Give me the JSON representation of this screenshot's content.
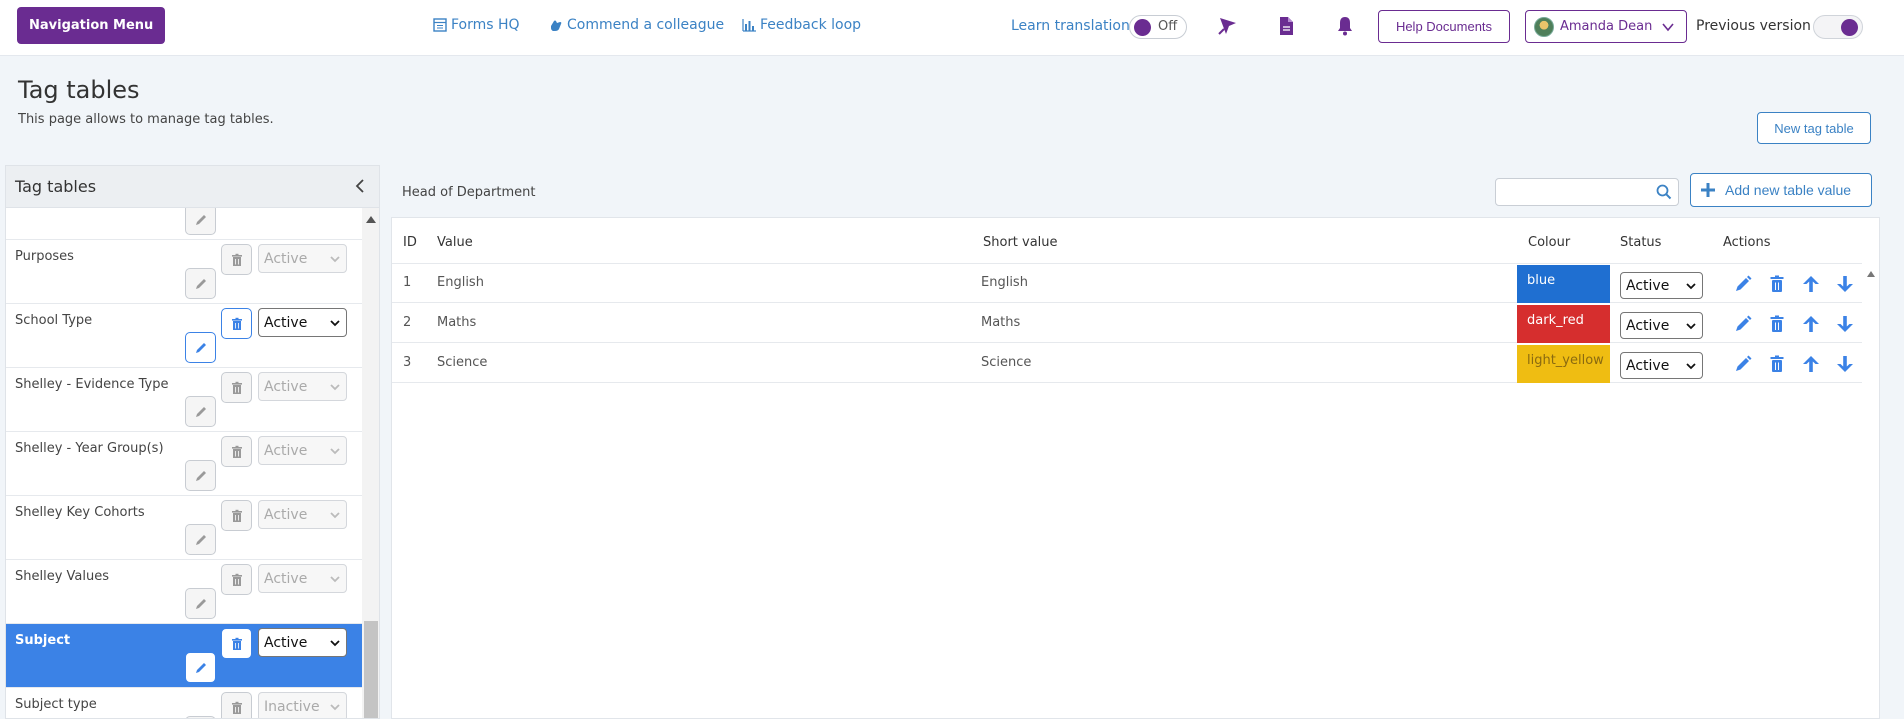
{
  "topbar": {
    "nav_menu_label": "Navigation Menu",
    "links": [
      {
        "label": "Forms HQ",
        "icon": "form-icon"
      },
      {
        "label": "Commend a colleague",
        "icon": "hand-icon"
      },
      {
        "label": "Feedback loop",
        "icon": "bar-chart-icon"
      }
    ],
    "learn_translation_label": "Learn translation",
    "translation_toggle_text": "Off",
    "help_documents_label": "Help Documents",
    "user_name": "Amanda Dean",
    "previous_version_label": "Previous version",
    "accent_color": "#6a2c91"
  },
  "page": {
    "title": "Tag tables",
    "description": "This page allows to manage tag tables.",
    "new_tag_table_label": "New tag table"
  },
  "left_panel": {
    "title": "Tag tables",
    "rows": [
      {
        "name": "",
        "status": "",
        "selected": false,
        "partial": true
      },
      {
        "name": "Purposes",
        "status": "Active",
        "selected": false
      },
      {
        "name": "School Type",
        "status": "Active",
        "selected": false,
        "enabled": true
      },
      {
        "name": "Shelley - Evidence Type",
        "status": "Active",
        "selected": false
      },
      {
        "name": "Shelley - Year Group(s)",
        "status": "Active",
        "selected": false
      },
      {
        "name": "Shelley Key Cohorts",
        "status": "Active",
        "selected": false
      },
      {
        "name": "Shelley Values",
        "status": "Active",
        "selected": false
      },
      {
        "name": "Subject",
        "status": "Active",
        "selected": true,
        "enabled": true
      },
      {
        "name": "Subject type",
        "status": "Inactive",
        "selected": false
      }
    ]
  },
  "main": {
    "subtitle": "Head of Department",
    "search_placeholder": "",
    "add_value_label": "Add new table value",
    "columns": [
      "ID",
      "Value",
      "Short value",
      "Colour",
      "Status",
      "Actions"
    ],
    "rows": [
      {
        "id": "1",
        "value": "English",
        "short_value": "English",
        "colour": "blue",
        "colour_hex": "#1f6fd1",
        "colour_text": "#ffffff",
        "status": "Active"
      },
      {
        "id": "2",
        "value": "Maths",
        "short_value": "Maths",
        "colour": "dark_red",
        "colour_hex": "#d62e2e",
        "colour_text": "#ffffff",
        "status": "Active"
      },
      {
        "id": "3",
        "value": "Science",
        "short_value": "Science",
        "colour": "light_yellow",
        "colour_hex": "#efbd12",
        "colour_text": "#8a6a10",
        "status": "Active"
      }
    ]
  }
}
